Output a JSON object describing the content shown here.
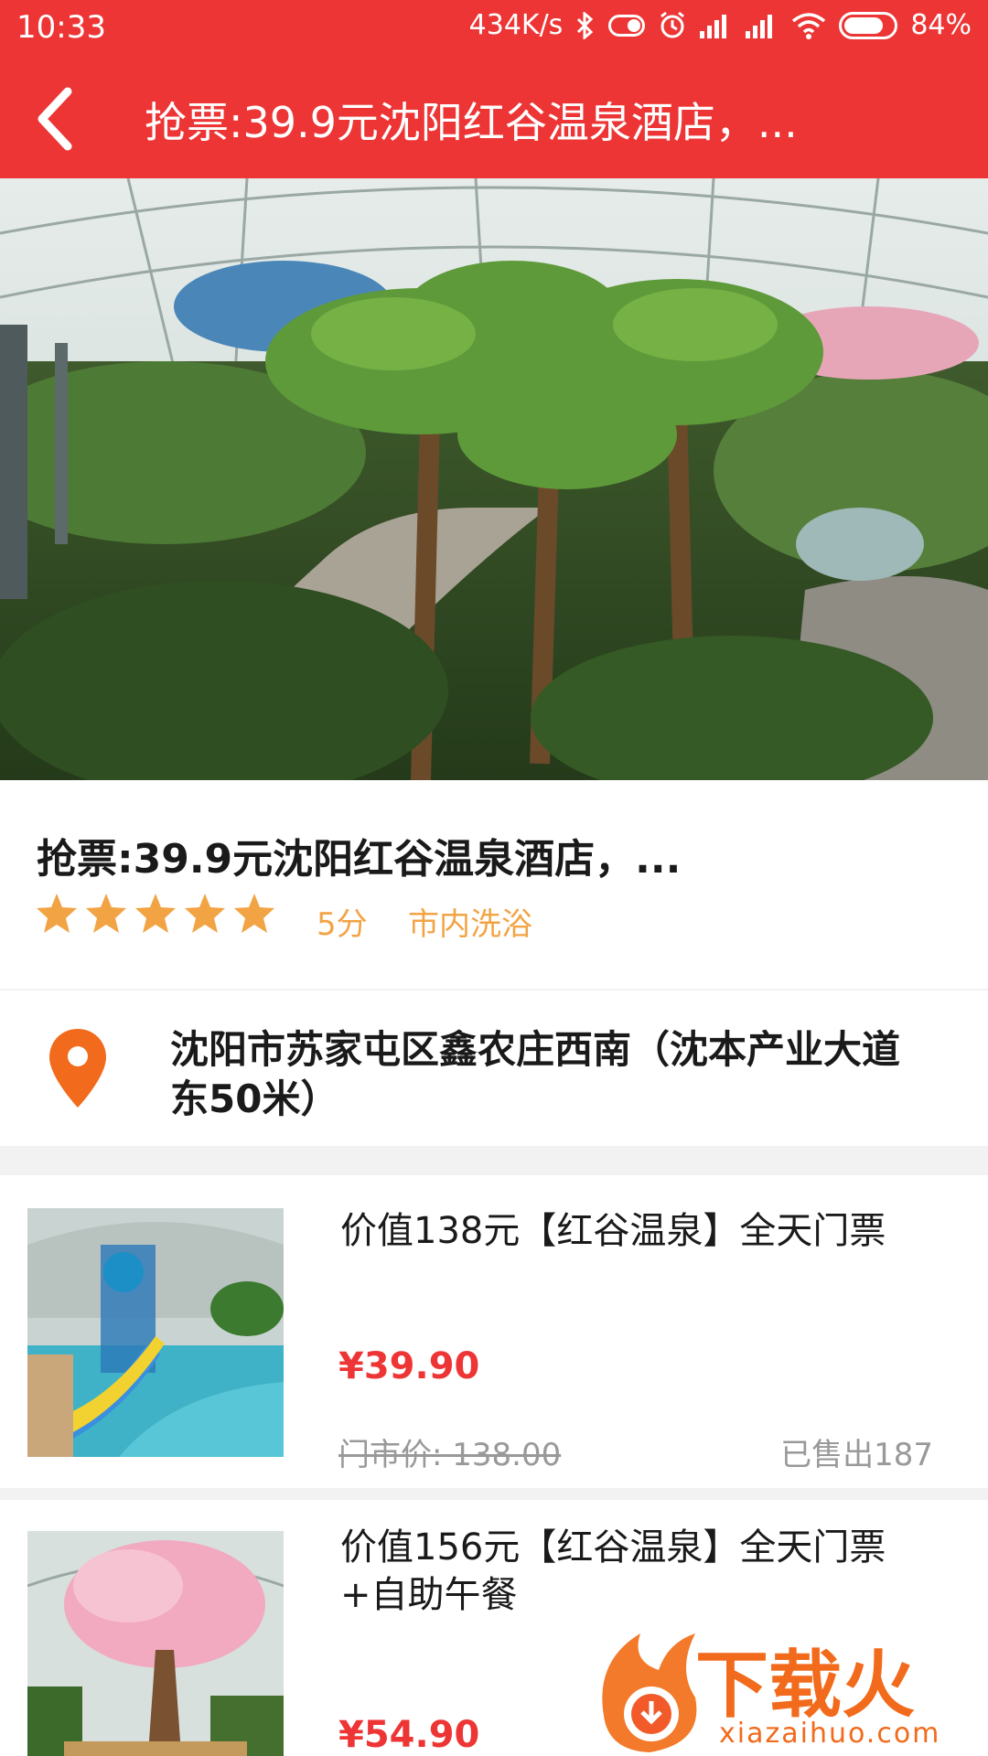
{
  "status_bar": {
    "time": "10:33",
    "speed": "434K/s",
    "battery": "84%"
  },
  "app_bar": {
    "title": "抢票:39.9元沈阳红谷温泉酒店，..."
  },
  "info": {
    "title": "抢票:39.9元沈阳红谷温泉酒店，...",
    "rating": 5,
    "score": "5分",
    "category": "市内洗浴"
  },
  "address": {
    "text": "沈阳市苏家屯区鑫农庄西南（沈本产业大道东50米）"
  },
  "tickets": [
    {
      "name": "价值138元【红谷温泉】全天门票",
      "price": "¥39.90",
      "original": "门市价: 138.00",
      "sold": "已售出187"
    },
    {
      "name": "价值156元【红谷温泉】全天门票+自助午餐",
      "price": "¥54.90"
    }
  ],
  "watermark": {
    "brand": "下载火",
    "domain": "xiazaihuo.com"
  },
  "colors": {
    "brand_red": "#ed3535",
    "star_orange": "#f2a445",
    "pin_orange": "#f26a1b"
  }
}
